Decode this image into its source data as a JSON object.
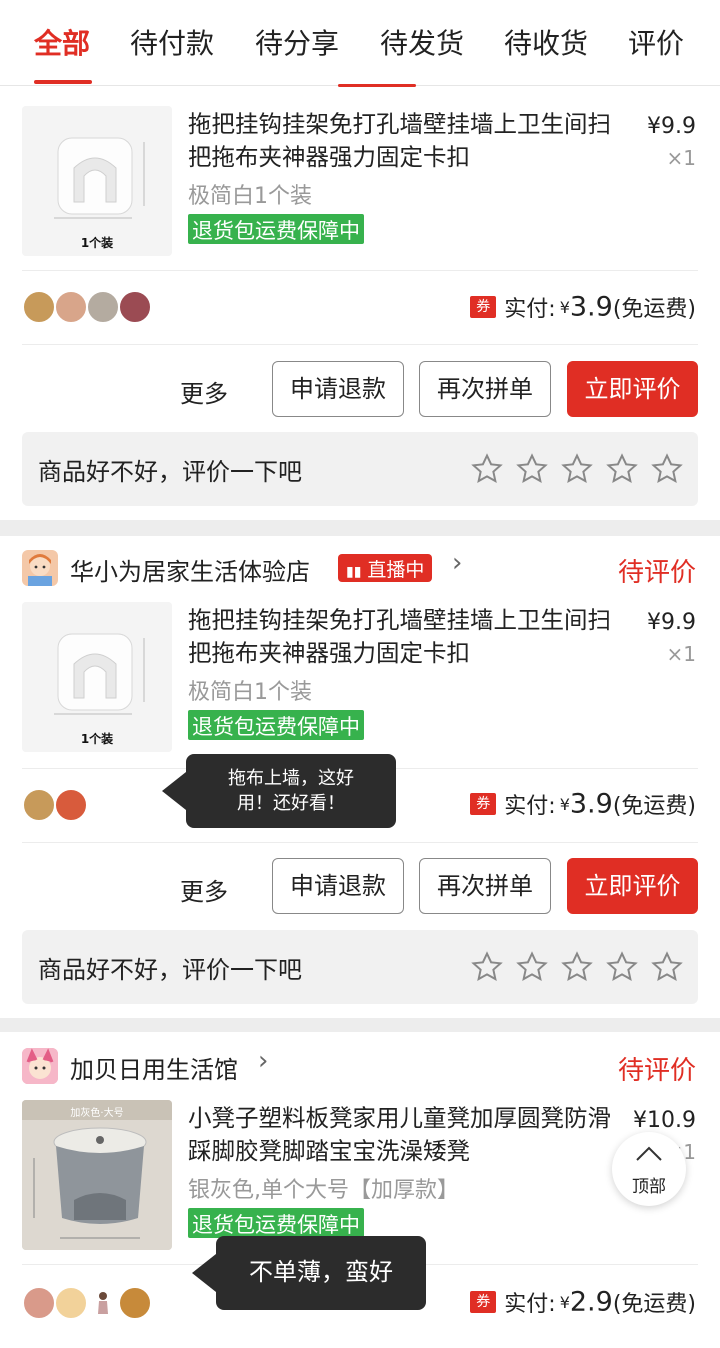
{
  "tabs": [
    "全部",
    "待付款",
    "待分享",
    "待发货",
    "待收货",
    "评价"
  ],
  "orders": [
    {
      "product": {
        "image_caption": "1个装",
        "title": "拖把挂钩挂架免打孔墙壁挂墙上卫生间扫把拖布夹神器强力固定卡扣",
        "price": "¥9.9",
        "qty": "×1",
        "spec": "极简白1个装",
        "guarantee": "退货包运费保障中"
      },
      "coupon": "券",
      "pay_label": "实付:",
      "pay_currency": "¥",
      "pay_amount": "3.9",
      "pay_note": "(免运费)",
      "actions": {
        "more": "更多",
        "refund": "申请退款",
        "rebuy": "再次拼单",
        "review": "立即评价"
      },
      "review_prompt": "商品好不好，评价一下吧"
    },
    {
      "shop_name": "华小为居家生活体验店",
      "live_badge": "直播中",
      "status": "待评价",
      "product": {
        "image_caption": "1个装",
        "title": "拖把挂钩挂架免打孔墙壁挂墙上卫生间扫把拖布夹神器强力固定卡扣",
        "price": "¥9.9",
        "qty": "×1",
        "spec": "极简白1个装",
        "guarantee": "退货包运费保障中"
      },
      "comment_bubble": [
        "拖布上墙，这好",
        "用！还好看！"
      ],
      "coupon": "券",
      "pay_label": "实付:",
      "pay_currency": "¥",
      "pay_amount": "3.9",
      "pay_note": "(免运费)",
      "actions": {
        "more": "更多",
        "refund": "申请退款",
        "rebuy": "再次拼单",
        "review": "立即评价"
      },
      "review_prompt": "商品好不好，评价一下吧"
    },
    {
      "shop_name": "加贝日用生活馆",
      "status": "待评价",
      "product": {
        "image_caption": "加灰色·大号",
        "title": "小凳子塑料板凳家用儿童凳加厚圆凳防滑踩脚胶凳脚踏宝宝洗澡矮凳",
        "price": "¥10.9",
        "qty": "×1",
        "spec": "银灰色,单个大号【加厚款】",
        "guarantee": "退货包运费保障中"
      },
      "comment_bubble": "不单薄，蛮好",
      "coupon": "券",
      "pay_label": "实付:",
      "pay_currency": "¥",
      "pay_amount": "2.9",
      "pay_note": "(免运费)"
    }
  ],
  "back_to_top": "顶部",
  "colors": {
    "accent": "#e02e24",
    "guarantee": "#37b24d",
    "bubble": "#2c2c2c"
  }
}
